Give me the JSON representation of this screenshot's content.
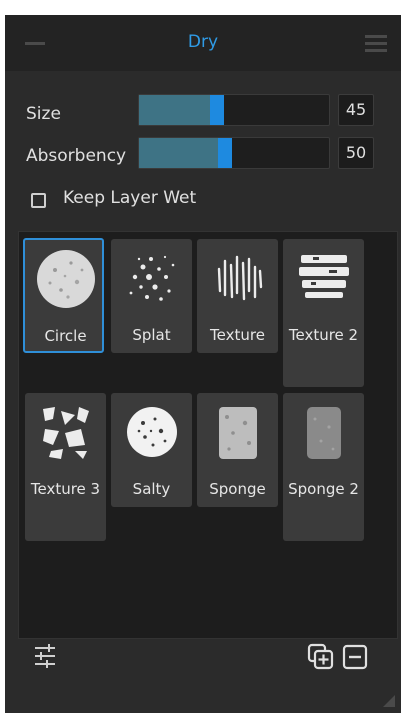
{
  "panel": {
    "title": "Dry",
    "collapse_icon": "minus-icon",
    "menu_icon": "hamburger-menu-icon"
  },
  "sliders": [
    {
      "label": "Size",
      "value": "45",
      "fill_fraction": 0.45
    },
    {
      "label": "Absorbency",
      "value": "50",
      "fill_fraction": 0.5
    }
  ],
  "keep_layer_wet": {
    "label": "Keep Layer Wet",
    "checked": false
  },
  "presets": [
    {
      "name": "Circle",
      "icon": "circle-brush-icon",
      "selected": true
    },
    {
      "name": "Splat",
      "icon": "splat-brush-icon",
      "selected": false
    },
    {
      "name": "Texture",
      "icon": "texture-brush-icon",
      "selected": false
    },
    {
      "name": "Texture 2",
      "icon": "texture2-brush-icon",
      "selected": false
    },
    {
      "name": "Texture 3",
      "icon": "texture3-brush-icon",
      "selected": false
    },
    {
      "name": "Salty",
      "icon": "salty-brush-icon",
      "selected": false
    },
    {
      "name": "Sponge",
      "icon": "sponge-brush-icon",
      "selected": false
    },
    {
      "name": "Sponge 2",
      "icon": "sponge2-brush-icon",
      "selected": false
    }
  ],
  "footer": {
    "settings_icon": "sliders-settings-icon",
    "duplicate_icon": "duplicate-preset-icon",
    "remove_icon": "remove-preset-icon"
  },
  "colors": {
    "accent": "#2f9be6",
    "slider_fill": "#3e7385",
    "handle": "#1e8ae0"
  }
}
